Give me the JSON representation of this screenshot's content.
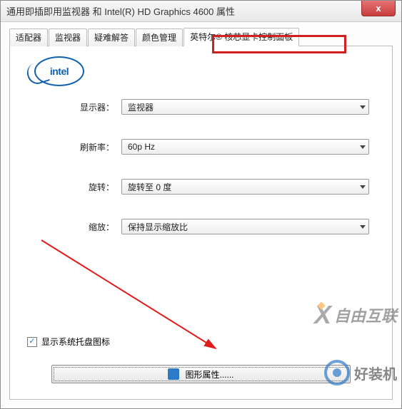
{
  "title": "通用即插即用监视器 和 Intel(R) HD Graphics 4600 属性",
  "close_x": "x",
  "tabs": [
    "适配器",
    "监视器",
    "疑难解答",
    "颜色管理",
    "英特尔® 核芯显卡控制面板"
  ],
  "active_tab_index": 4,
  "logo_text": "intel",
  "rows": {
    "display": {
      "label": "显示器：",
      "value": "监视器"
    },
    "refresh": {
      "label": "刷新率：",
      "value": "60p Hz"
    },
    "rotation": {
      "label": "旋转：",
      "value": "旋转至 0 度"
    },
    "scaling": {
      "label": "缩放：",
      "value": "保持显示缩放比"
    }
  },
  "tray_checkbox": {
    "checked": true,
    "label": "显示系统托盘图标"
  },
  "bottom_button": "图形属性......",
  "watermark1": "自由互联",
  "watermark2": "好装机"
}
